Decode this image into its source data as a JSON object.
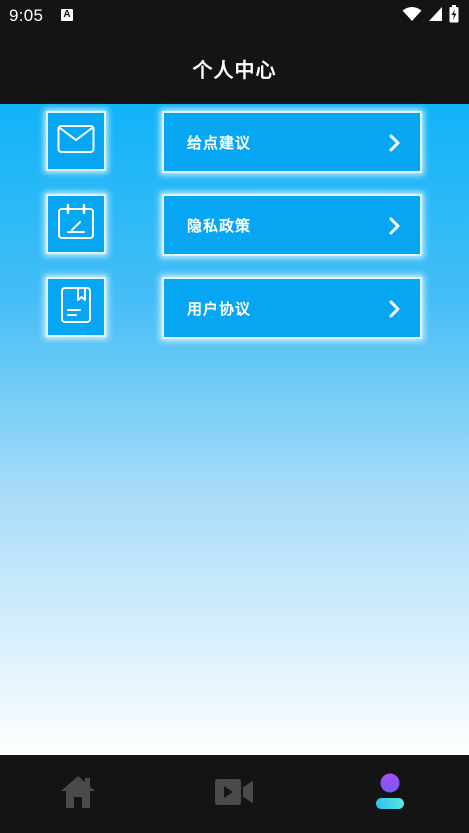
{
  "status_bar": {
    "time": "9:05",
    "badge": "A"
  },
  "header": {
    "title": "个人中心"
  },
  "menu": {
    "items": [
      {
        "label": "给点建议",
        "icon": "mail-icon"
      },
      {
        "label": "隐私政策",
        "icon": "calendar-edit-icon"
      },
      {
        "label": "用户协议",
        "icon": "document-bookmark-icon"
      }
    ]
  },
  "bottom_nav": {
    "items": [
      {
        "icon": "home-icon",
        "active": false
      },
      {
        "icon": "video-camera-icon",
        "active": false
      },
      {
        "icon": "profile-icon",
        "active": true
      }
    ]
  },
  "colors": {
    "bar_background": "#141414",
    "button_fill": "#07a6f2",
    "button_border": "#dff6ff",
    "gradient_top": "#10b3f8",
    "nav_inactive": "#4a4a4a",
    "nav_active_top": "#8c52f5",
    "nav_active_bottom": "#3fd6e6"
  }
}
